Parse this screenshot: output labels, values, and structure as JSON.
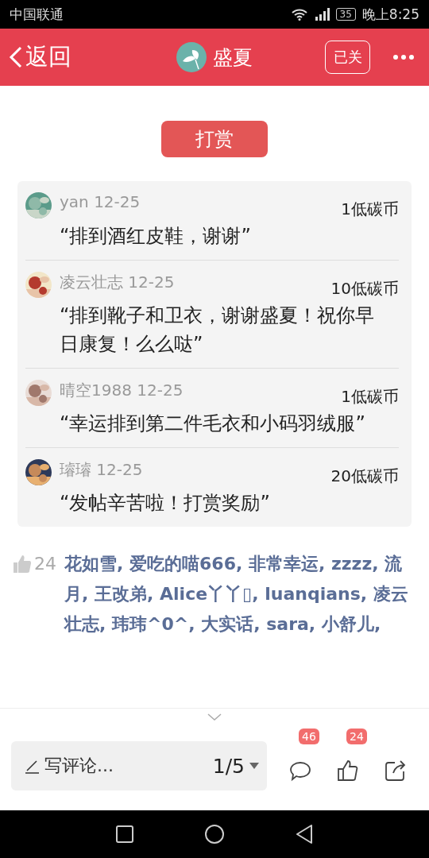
{
  "status_bar": {
    "carrier": "中国联通",
    "battery": "35",
    "time": "晚上8:25"
  },
  "header": {
    "back": "返回",
    "author": "盛夏",
    "follow": "已关"
  },
  "reward_button": "打赏",
  "rewards": [
    {
      "name": "yan",
      "date": "12-25",
      "amount": "1低碳币",
      "message": "“排到酒红皮鞋，谢谢”"
    },
    {
      "name": "凌云壮志",
      "date": "12-25",
      "amount": "10低碳币",
      "message": "“排到靴子和卫衣，谢谢盛夏！祝你早日康复！么么哒”"
    },
    {
      "name": "晴空1988",
      "date": "12-25",
      "amount": "1低碳币",
      "message": "“幸运排到第二件毛衣和小码羽绒服”"
    },
    {
      "name": "璿璿",
      "date": "12-25",
      "amount": "20低碳币",
      "message": "“发帖辛苦啦！打赏奖励”"
    }
  ],
  "likes": {
    "count": "24",
    "names": "花如雪, 爱吃的喵666, 非常幸运, zzzz, 流月, 王改弟, Alice丫丫▯, luanqians, 凌云壮志, 玮玮^0^, 大实话, sara, 小舒儿,"
  },
  "bottom_bar": {
    "placeholder": "写评论...",
    "page": "1/5",
    "comments_badge": "46",
    "likes_badge": "24"
  }
}
